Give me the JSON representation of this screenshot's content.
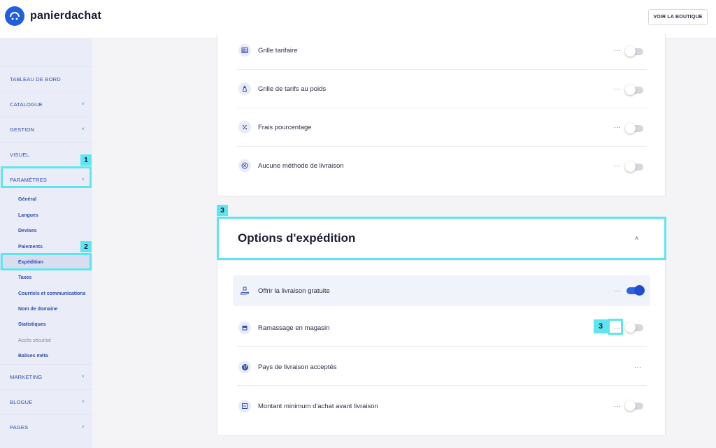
{
  "app": {
    "brand": "panierdachat",
    "shop_button": "VOIR LA BOUTIQUE"
  },
  "sidebar": {
    "items": [
      {
        "label": "TABLEAU DE BORD",
        "chevron": ""
      },
      {
        "label": "CATALOGUE",
        "chevron": "˅"
      },
      {
        "label": "GESTION",
        "chevron": "˅"
      },
      {
        "label": "VISUEL",
        "chevron": ""
      },
      {
        "label": "PARAMÈTRES",
        "chevron": "˄"
      }
    ],
    "subitems": [
      {
        "label": "Général"
      },
      {
        "label": "Langues"
      },
      {
        "label": "Devises"
      },
      {
        "label": "Paiements"
      },
      {
        "label": "Expédition"
      },
      {
        "label": "Taxes"
      },
      {
        "label": "Courriels et communications"
      },
      {
        "label": "Nom de domaine"
      },
      {
        "label": "Statistiques"
      },
      {
        "label": "Accès sécurisé"
      },
      {
        "label": "Balises méta"
      }
    ],
    "bottom_items": [
      {
        "label": "MARKETING",
        "chevron": "˅"
      },
      {
        "label": "BLOGUE",
        "chevron": "˅"
      },
      {
        "label": "PAGES",
        "chevron": "˅"
      }
    ]
  },
  "annotations": {
    "one": "1",
    "two": "2",
    "three_a": "3",
    "three_b": "3"
  },
  "shipping_methods": {
    "rows": [
      {
        "label": "Grille tarifaire",
        "icon": "table-icon",
        "dots": "···",
        "enabled": false
      },
      {
        "label": "Grille de tarifs au poids",
        "icon": "weight-icon",
        "dots": "···",
        "enabled": false
      },
      {
        "label": "Frais pourcentage",
        "icon": "percent-icon",
        "dots": "···",
        "enabled": false
      },
      {
        "label": "Aucune méthode de livraison",
        "icon": "cross-circle-icon",
        "dots": "···",
        "enabled": false
      }
    ]
  },
  "shipping_options": {
    "title": "Options d'expédition",
    "collapse_glyph": "˄",
    "rows": [
      {
        "label": "Offrir la livraison gratuite",
        "icon": "hand-package-icon",
        "dots": "···",
        "enabled": true
      },
      {
        "label": "Ramassage en magasin",
        "icon": "store-icon",
        "dots": "···",
        "enabled": false
      },
      {
        "label": "Pays de livraison acceptés",
        "icon": "globe-icon",
        "dots": "···"
      },
      {
        "label": "Montant minimum d'achat avant livraison",
        "icon": "minus-box-icon",
        "dots": "···",
        "enabled": false
      }
    ]
  },
  "colors": {
    "accent": "#1f5fe0",
    "highlight": "#5ee6f0"
  }
}
